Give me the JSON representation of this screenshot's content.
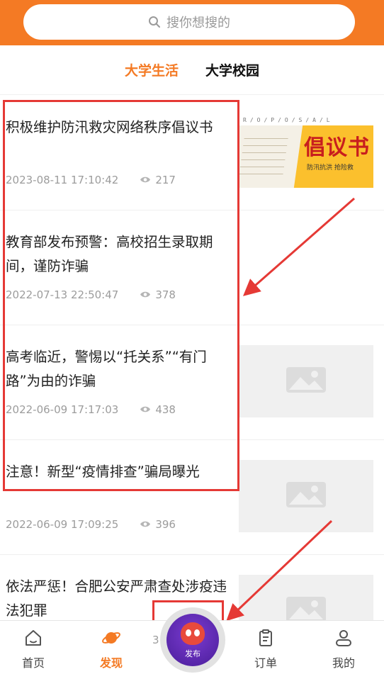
{
  "search": {
    "placeholder": "搜你想搜的"
  },
  "tabs": [
    {
      "label": "大学生活",
      "active": true
    },
    {
      "label": "大学校园",
      "active": false
    }
  ],
  "articles": [
    {
      "title": "积极维护防汛救灾网络秩序倡议书",
      "date": "2023-08-11 17:10:42",
      "views": "217",
      "thumb": "banner"
    },
    {
      "title": "教育部发布预警：高校招生录取期间，谨防诈骗",
      "date": "2022-07-13 22:50:47",
      "views": "378",
      "thumb": "none"
    },
    {
      "title": "高考临近，警惕以“托关系”“有门路”为由的诈骗",
      "date": "2022-06-09 17:17:03",
      "views": "438",
      "thumb": "placeholder"
    },
    {
      "title": "注意！新型“疫情排查”骗局曝光",
      "date": "2022-06-09 17:09:25",
      "views": "396",
      "thumb": "placeholder"
    },
    {
      "title": "依法严惩！合肥公安严肃查处涉疫违法犯罪",
      "date": "",
      "views": "",
      "thumb": "placeholder"
    }
  ],
  "banner": {
    "strip_text": "R/O/P/O/S/A/L",
    "big_text": "倡议书",
    "small_text": "防汛抗洪   抢险救"
  },
  "nav": {
    "home": "首页",
    "discover": "发现",
    "publish": "发布",
    "orders": "订单",
    "mine": "我的",
    "partial_digit": "3"
  },
  "colors": {
    "accent": "#f47a24",
    "highlight": "#e53935",
    "placeholder": "#f0f0f0"
  }
}
